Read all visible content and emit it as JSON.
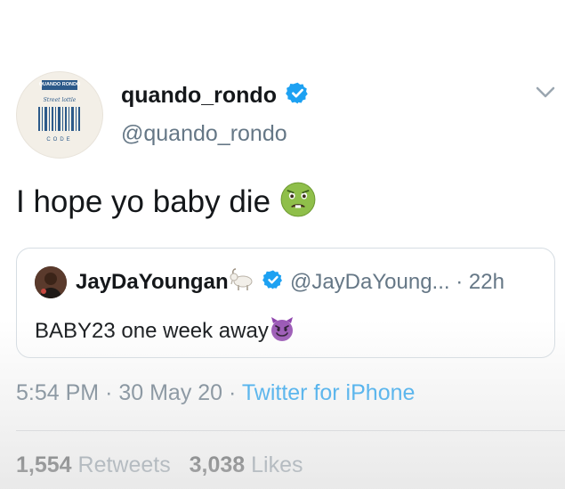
{
  "tweet": {
    "author": {
      "display_name": "quando_rondo",
      "handle": "@quando_rondo",
      "verified": true,
      "avatar_text_top": "QUANDO RONDO",
      "avatar_text_script": "Street lottle",
      "avatar_text_bottom": "CODE"
    },
    "text": "I hope yo baby die",
    "text_emoji": "nauseated-face",
    "quoted": {
      "display_name": "JayDaYoungan",
      "name_emoji": "goat",
      "verified": true,
      "handle": "@JayDaYoung...",
      "time": "· 22h",
      "text": "BABY23 one week away",
      "text_emoji": "smiling-devil"
    },
    "time": "5:54 PM",
    "date": "30 May 20",
    "source": "Twitter for iPhone",
    "retweets": {
      "count": "1,554",
      "label": "Retweets"
    },
    "likes": {
      "count": "3,038",
      "label": "Likes"
    }
  },
  "colors": {
    "link": "#1da1f2",
    "secondary_text": "#657786",
    "primary_text": "#14171a",
    "verified": "#1da1f2"
  }
}
